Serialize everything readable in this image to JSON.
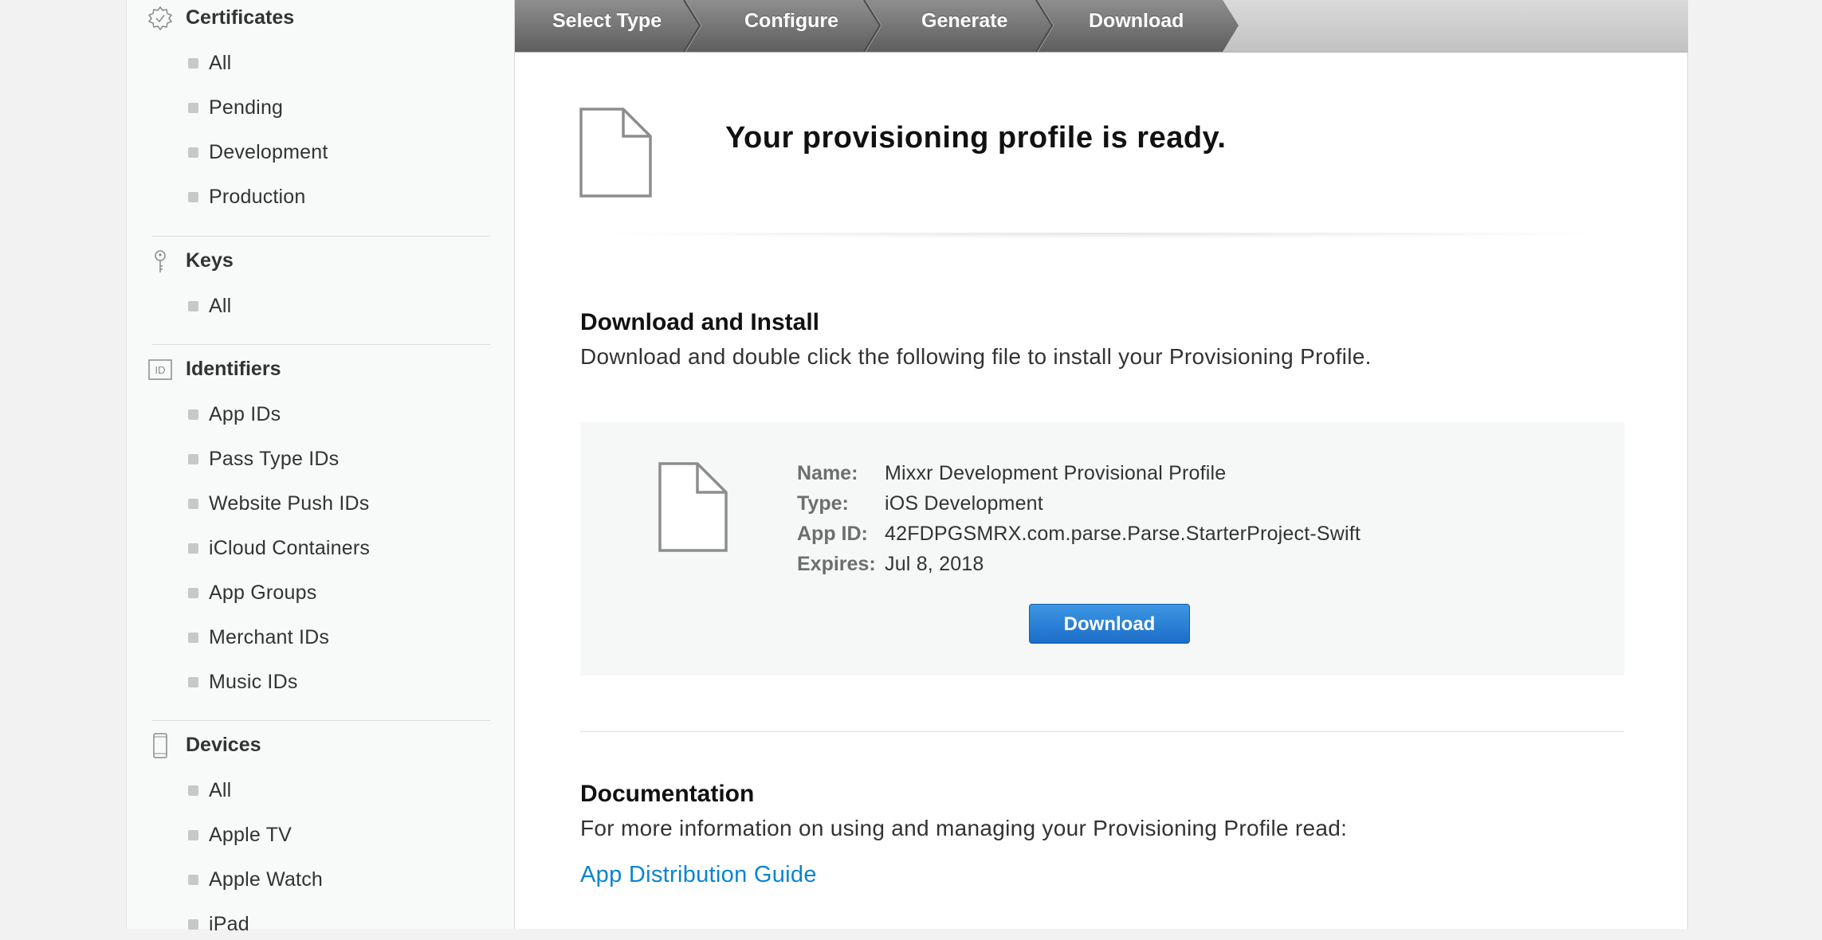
{
  "sidebar": {
    "certificates": {
      "title": "Certificates",
      "items": [
        {
          "label": "All"
        },
        {
          "label": "Pending"
        },
        {
          "label": "Development"
        },
        {
          "label": "Production"
        }
      ]
    },
    "keys": {
      "title": "Keys",
      "items": [
        {
          "label": "All"
        }
      ]
    },
    "identifiers": {
      "title": "Identifiers",
      "items": [
        {
          "label": "App IDs"
        },
        {
          "label": "Pass Type IDs"
        },
        {
          "label": "Website Push IDs"
        },
        {
          "label": "iCloud Containers"
        },
        {
          "label": "App Groups"
        },
        {
          "label": "Merchant IDs"
        },
        {
          "label": "Music IDs"
        }
      ]
    },
    "devices": {
      "title": "Devices",
      "items": [
        {
          "label": "All"
        },
        {
          "label": "Apple TV"
        },
        {
          "label": "Apple Watch"
        },
        {
          "label": "iPad"
        }
      ]
    }
  },
  "steps": [
    {
      "label": "Select Type"
    },
    {
      "label": "Configure"
    },
    {
      "label": "Generate"
    },
    {
      "label": "Download"
    }
  ],
  "main": {
    "ready_title": "Your provisioning profile is ready.",
    "install": {
      "title": "Download and Install",
      "text": "Download and double click the following file to install your Provisioning Profile."
    },
    "profile": {
      "name_label": "Name:",
      "name_value": "Mixxr Development Provisional Profile",
      "type_label": "Type:",
      "type_value": "iOS Development",
      "appid_label": "App ID:",
      "appid_value": "42FDPGSMRX.com.parse.Parse.StarterProject-Swift",
      "expires_label": "Expires:",
      "expires_value": "Jul 8, 2018",
      "download_label": "Download"
    },
    "documentation": {
      "title": "Documentation",
      "text": "For more information on using and managing your Provisioning Profile read:",
      "link": "App Distribution Guide"
    }
  },
  "colors": {
    "accent_blue": "#1c6ec8",
    "link_blue": "#0a84d0",
    "step_bar": "#c2c2c2"
  }
}
